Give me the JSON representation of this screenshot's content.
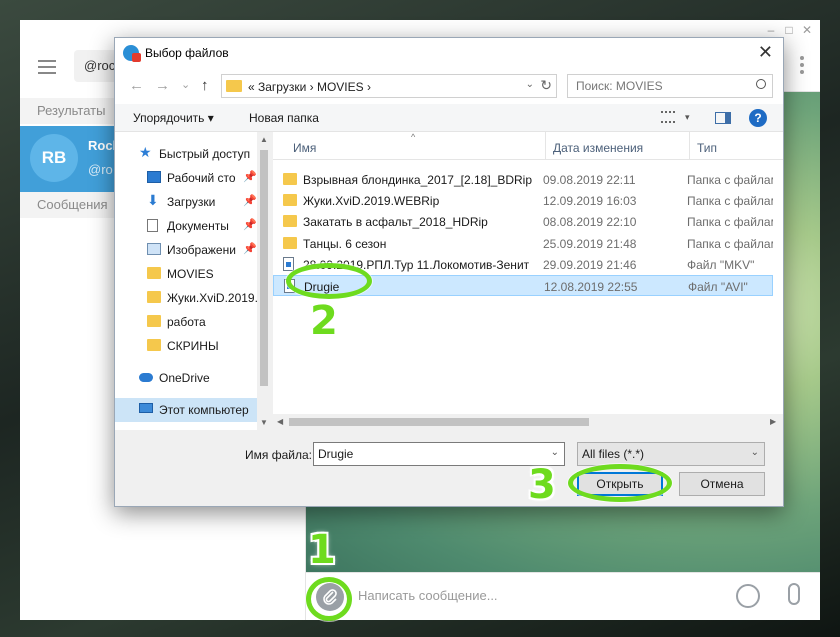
{
  "telegram": {
    "search_value": "@roc",
    "results_label": "Результаты",
    "chat": {
      "avatar": "RB",
      "name": "Rock",
      "sub": "@ro"
    },
    "messages_label": "Сообщения",
    "compose_placeholder": "Написать сообщение...",
    "window_controls": {
      "minimize": "–",
      "maximize": "□",
      "close": "✕"
    }
  },
  "dialog": {
    "title": "Выбор файлов",
    "close_glyph": "✕",
    "nav": {
      "back": "←",
      "forward": "→",
      "dropdown": "⌄",
      "up": "↑"
    },
    "address": "«  Загрузки  ›  MOVIES  ›",
    "address_dropdown": "⌄",
    "refresh": "↻",
    "search_placeholder": "Поиск: MOVIES",
    "toolbar": {
      "organize": "Упорядочить ▾",
      "new_folder": "Новая папка",
      "views_dropdown": "▾",
      "help": "?"
    },
    "nav_pane": [
      {
        "name": "nav-quick-access",
        "label": "Быстрый доступ",
        "icon": "star",
        "pin": ""
      },
      {
        "name": "nav-desktop",
        "label": "Рабочий сто",
        "icon": "desktop",
        "pin": "📌"
      },
      {
        "name": "nav-downloads",
        "label": "Загрузки",
        "icon": "download",
        "pin": "📌"
      },
      {
        "name": "nav-documents",
        "label": "Документы",
        "icon": "doc",
        "pin": "📌"
      },
      {
        "name": "nav-pictures",
        "label": "Изображени",
        "icon": "image",
        "pin": "📌"
      },
      {
        "name": "nav-movies",
        "label": "MOVIES",
        "icon": "folder",
        "pin": ""
      },
      {
        "name": "nav-zhuki",
        "label": "Жуки.XviD.2019.",
        "icon": "folder",
        "pin": ""
      },
      {
        "name": "nav-rabota",
        "label": "работа",
        "icon": "folder",
        "pin": ""
      },
      {
        "name": "nav-skriny",
        "label": "СКРИНЫ",
        "icon": "folder",
        "pin": ""
      },
      {
        "name": "nav-onedrive",
        "label": "OneDrive",
        "icon": "cloud",
        "pin": ""
      },
      {
        "name": "nav-thiscomputer",
        "label": "Этот компьютер",
        "icon": "pc",
        "pin": ""
      }
    ],
    "scroll": {
      "up": "▲",
      "down": "▼",
      "left": "◀",
      "right": "▶"
    },
    "columns": {
      "name": "Имя",
      "date": "Дата изменения",
      "type": "Тип",
      "sort_caret": "^"
    },
    "files": [
      {
        "name": "Взрывная блондинка_2017_[2.18]_BDRip",
        "date": "09.08.2019 22:11",
        "type": "Папка с файлами",
        "icon": "folder"
      },
      {
        "name": "Жуки.XviD.2019.WEBRip",
        "date": "12.09.2019 16:03",
        "type": "Папка с файлами",
        "icon": "folder"
      },
      {
        "name": "Закатать в асфальт_2018_HDRip",
        "date": "08.08.2019 22:10",
        "type": "Папка с файлами",
        "icon": "folder"
      },
      {
        "name": "Танцы. 6 сезон",
        "date": "25.09.2019 21:48",
        "type": "Папка с файлами",
        "icon": "folder"
      },
      {
        "name": "28.09.2019.РПЛ.Тур 11.Локомотив-Зенит",
        "date": "29.09.2019 21:46",
        "type": "Файл \"MKV\"",
        "icon": "file"
      },
      {
        "name": "Drugie",
        "date": "12.08.2019 22:55",
        "type": "Файл \"AVI\"",
        "icon": "file",
        "selected": true
      }
    ],
    "filename_label": "Имя файла:",
    "filename_value": "Drugie",
    "filetype_value": "All files (*.*)",
    "open_label": "Открыть",
    "cancel_label": "Отмена"
  },
  "annotations": {
    "step1": "1",
    "step2": "2",
    "step3": "3"
  },
  "colors": {
    "accent": "#6edb1e",
    "telegram_blue": "#419fd9",
    "selection": "#cce8ff"
  }
}
